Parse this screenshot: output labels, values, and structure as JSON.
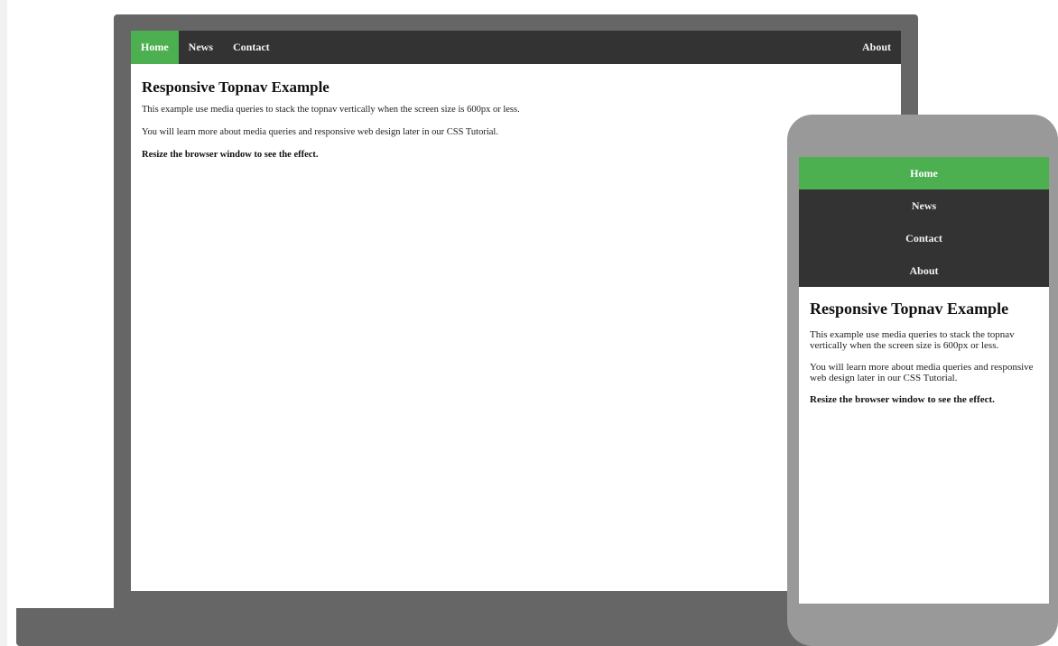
{
  "laptop": {
    "nav": {
      "home": "Home",
      "news": "News",
      "contact": "Contact",
      "about": "About"
    },
    "content": {
      "title": "Responsive Topnav Example",
      "paragraph1": "This example use media queries to stack the topnav vertically when the screen size is 600px or less.",
      "paragraph2": "You will learn more about media queries and responsive web design later in our CSS Tutorial.",
      "paragraph3": "Resize the browser window to see the effect."
    }
  },
  "phone": {
    "nav": {
      "home": "Home",
      "news": "News",
      "contact": "Contact",
      "about": "About"
    },
    "content": {
      "title": "Responsive Topnav Example",
      "paragraph1": "This example use media queries to stack the topnav vertically when the screen size is 600px or less.",
      "paragraph2": "You will learn more about media queries and responsive web design later in our CSS Tutorial.",
      "paragraph3": "Resize the browser window to see the effect."
    }
  },
  "colors": {
    "nav_background": "#333333",
    "active_background": "#4caf50",
    "device_frame_laptop": "#666666",
    "device_frame_phone": "#999999"
  }
}
